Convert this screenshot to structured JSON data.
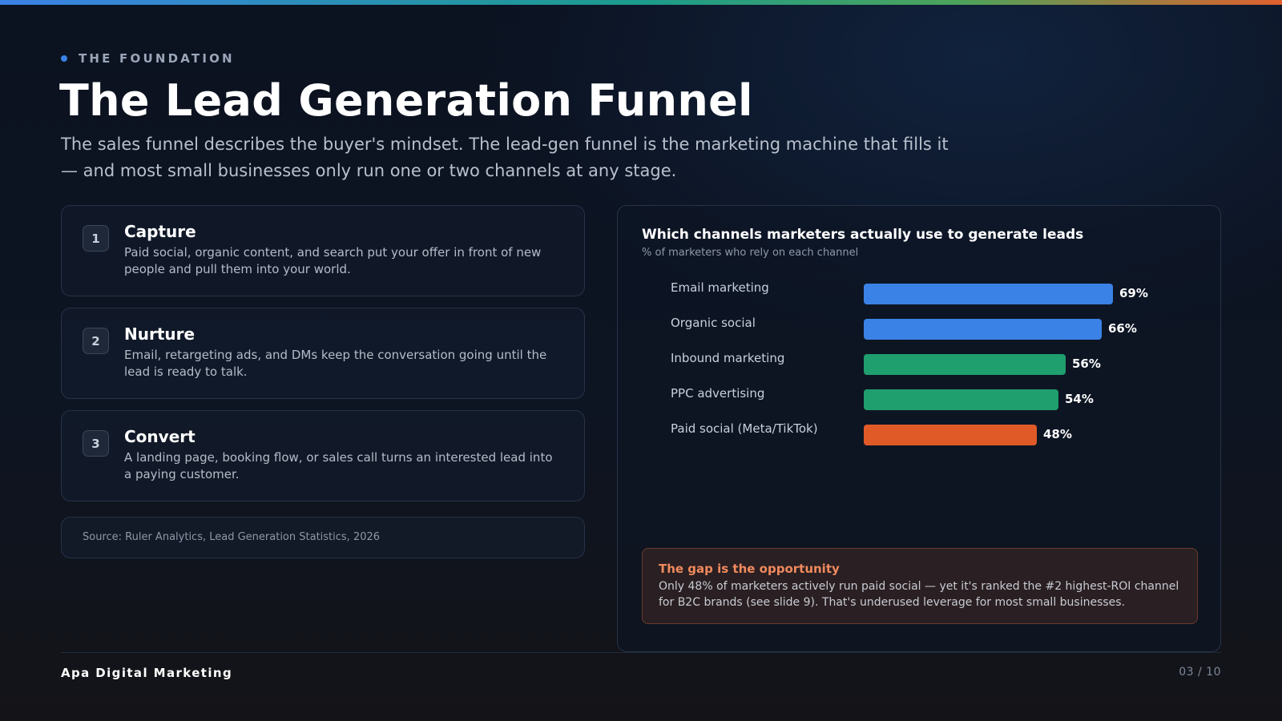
{
  "eyebrow": "THE FOUNDATION",
  "title": "The Lead Generation Funnel",
  "subtitle": "The sales funnel describes the buyer's mindset. The lead-gen funnel is the marketing machine that fills it — and most small businesses only run one or two channels at any stage.",
  "steps": [
    {
      "num": "1",
      "title": "Capture",
      "desc": "Paid social, organic content, and search put your offer in front of new people and pull them into your world."
    },
    {
      "num": "2",
      "title": "Nurture",
      "desc": "Email, retargeting ads, and DMs keep the conversation going until the lead is ready to talk."
    },
    {
      "num": "3",
      "title": "Convert",
      "desc": "A landing page, booking flow, or sales call turns an interested lead into a paying customer."
    }
  ],
  "source": "Source: Ruler Analytics, Lead Generation Statistics, 2026",
  "chart_panel": {
    "title": "Which channels marketers actually use to generate leads",
    "subtitle": "% of marketers who rely on each channel"
  },
  "chart_data": {
    "type": "bar",
    "orientation": "horizontal",
    "title": "Which channels marketers actually use to generate leads",
    "subtitle": "% of marketers who rely on each channel",
    "categories": [
      "Email marketing",
      "Organic social",
      "Inbound marketing",
      "PPC advertising",
      "Paid social (Meta/TikTok)"
    ],
    "values": [
      69,
      66,
      56,
      54,
      48
    ],
    "value_labels": [
      "69%",
      "66%",
      "56%",
      "54%",
      "48%"
    ],
    "bar_colors": [
      "#3b82e6",
      "#3b82e6",
      "#1f9e6e",
      "#1f9e6e",
      "#e05a28"
    ],
    "xlim": [
      0,
      100
    ],
    "grid": false
  },
  "callout": {
    "title": "The gap is the opportunity",
    "text": "Only 48% of marketers actively run paid social — yet it's ranked the #2 highest-ROI channel for B2C brands (see slide 9). That's underused leverage for most small businesses."
  },
  "footer": {
    "brand": "Apa Digital Marketing",
    "page": "03 / 10"
  },
  "colors": {
    "accent_blue": "#3b82e6",
    "accent_green": "#1f9e6e",
    "accent_orange": "#e05a28",
    "background": "#0b1220"
  }
}
